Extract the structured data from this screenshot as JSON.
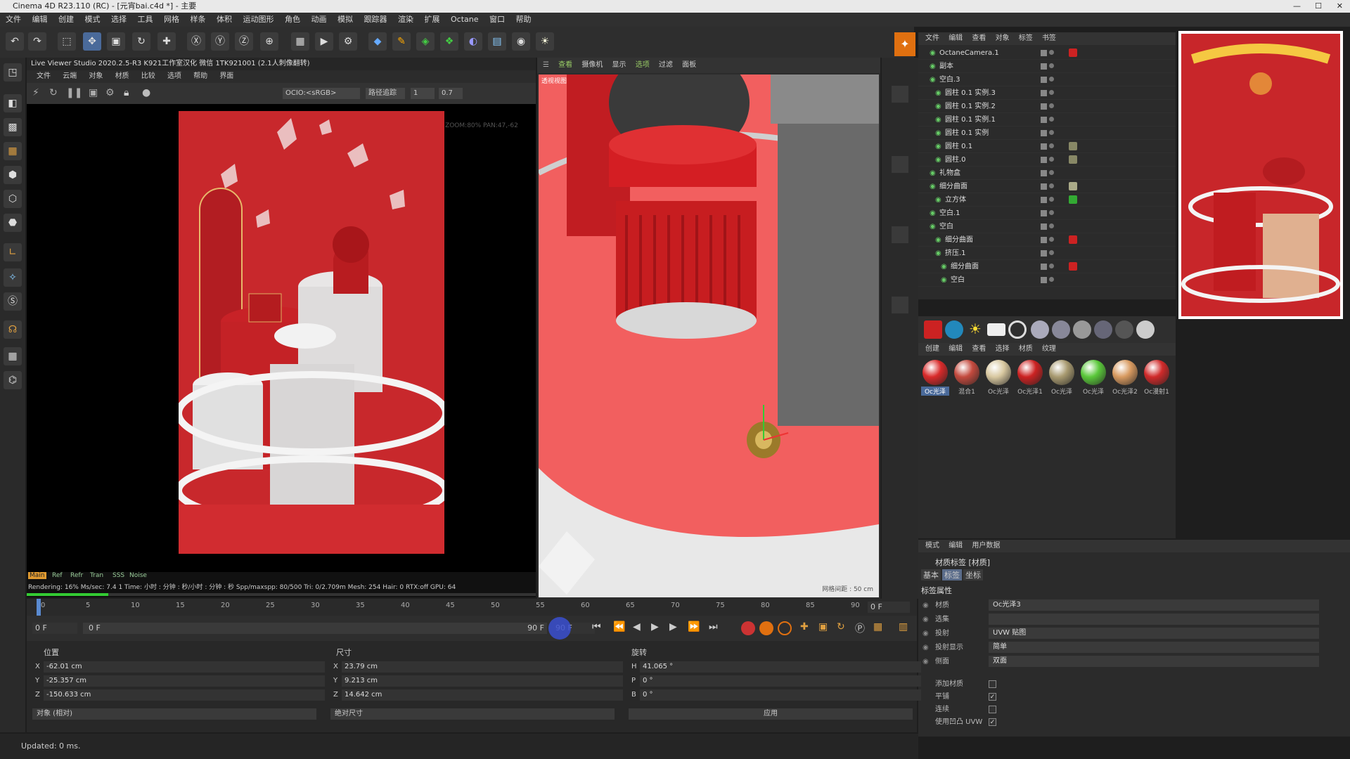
{
  "window": {
    "title": "Cinema 4D R23.110 (RC) - [元宵bai.c4d *] - 主要"
  },
  "menu": [
    "文件",
    "编辑",
    "创建",
    "模式",
    "选择",
    "工具",
    "网格",
    "样条",
    "体积",
    "运动图形",
    "角色",
    "动画",
    "模拟",
    "跟踪器",
    "渲染",
    "扩展",
    "Octane",
    "窗口",
    "帮助"
  ],
  "live_viewer": {
    "title": "Live Viewer Studio 2020.2.5-R3  K921工作室汉化  微信 1TK921001  (2.1人刺像翻转)",
    "menu": [
      "文件",
      "云端",
      "对象",
      "材质",
      "比较",
      "选项",
      "帮助",
      "界面"
    ],
    "ocio": "OCIO:<sRGB>",
    "mode": "路径追踪",
    "val1": "1",
    "val2": "0.7",
    "overlay": "fps 11.60 ZOOM:80% PAN:47,-62",
    "channels": [
      "Main",
      "Ref",
      "Refr",
      "Tran",
      "SSS",
      "Noise"
    ],
    "status": "Rendering: 16%  Ms/sec: 7.4 1   Time: 小时 : 分钟 : 秒/小时 : 分钟 : 秒   Spp/maxspp: 80/500   Tri: 0/2.709m  Mesh: 254  Hair: 0   RTX:off   GPU:  64",
    "progress": 0.16
  },
  "viewport": {
    "menu": [
      "查看",
      "摄像机",
      "显示",
      "选项",
      "过滤",
      "面板"
    ],
    "label": "透视视图",
    "grid": "网格间距 : 50 cm"
  },
  "object_manager": {
    "menu": [
      "文件",
      "编辑",
      "查看",
      "对象",
      "标签",
      "书签"
    ],
    "objects": [
      "OctaneCamera.1",
      "副本",
      "空白.3",
      "圆柱 0.1 实例.3",
      "圆柱 0.1 实例.2",
      "圆柱 0.1 实例.1",
      "圆柱 0.1 实例",
      "圆柱 0.1",
      "圆柱.0",
      "礼物盒",
      "细分曲面",
      "立方体",
      "空白.1",
      "空白",
      "细分曲面",
      "挤压.1",
      "细分曲面",
      "空白"
    ]
  },
  "material_manager": {
    "menu": [
      "创建",
      "编辑",
      "查看",
      "选择",
      "材质",
      "纹理"
    ],
    "materials": [
      "Oc光泽",
      "混合1",
      "Oc光泽",
      "Oc光泽1",
      "Oc光泽",
      "Oc光泽",
      "Oc光泽2",
      "Oc漫射1"
    ],
    "colors": [
      "#d92a2a",
      "#c44a3e",
      "#d8c8a0",
      "#cc2222",
      "#a89a70",
      "#5ac83a",
      "#d89a60",
      "#d02a2a"
    ]
  },
  "attributes": {
    "menu": [
      "模式",
      "编辑",
      "用户数据"
    ],
    "title": "材质标签 [材质]",
    "tabs": [
      "基本",
      "标签",
      "坐标"
    ],
    "section": "标签属性",
    "rows": [
      {
        "label": "材质",
        "value": "Oc光泽3"
      },
      {
        "label": "选集",
        "value": ""
      },
      {
        "label": "投射",
        "value": "UVW 贴图"
      },
      {
        "label": "投射显示",
        "value": "简单"
      },
      {
        "label": "侧面",
        "value": "双面"
      }
    ],
    "checks": [
      "添加材质",
      "平铺",
      "连续",
      "使用凹凸 UVW"
    ]
  },
  "timeline": {
    "ticks": [
      "0",
      "5",
      "10",
      "15",
      "20",
      "25",
      "30",
      "35",
      "40",
      "45",
      "50",
      "55",
      "60",
      "65",
      "70",
      "75",
      "80",
      "85",
      "90"
    ],
    "current": "0 F",
    "start": "0 F",
    "range_start": "0 F",
    "range_end": "90 F",
    "end": "90 F"
  },
  "coords": {
    "headers": [
      "位置",
      "尺寸",
      "旋转"
    ],
    "pos": [
      {
        "ax": "X",
        "v": "-62.01 cm"
      },
      {
        "ax": "Y",
        "v": "-25.357 cm"
      },
      {
        "ax": "Z",
        "v": "-150.633 cm"
      }
    ],
    "size": [
      {
        "ax": "X",
        "v": "23.79 cm"
      },
      {
        "ax": "Y",
        "v": "9.213 cm"
      },
      {
        "ax": "Z",
        "v": "14.642 cm"
      }
    ],
    "rot": [
      {
        "ax": "H",
        "v": "41.065 °"
      },
      {
        "ax": "P",
        "v": "0 °"
      },
      {
        "ax": "B",
        "v": "0 °"
      }
    ],
    "mode1": "对象 (相对)",
    "mode2": "绝对尺寸",
    "apply": "应用"
  },
  "status": "Updated: 0 ms."
}
